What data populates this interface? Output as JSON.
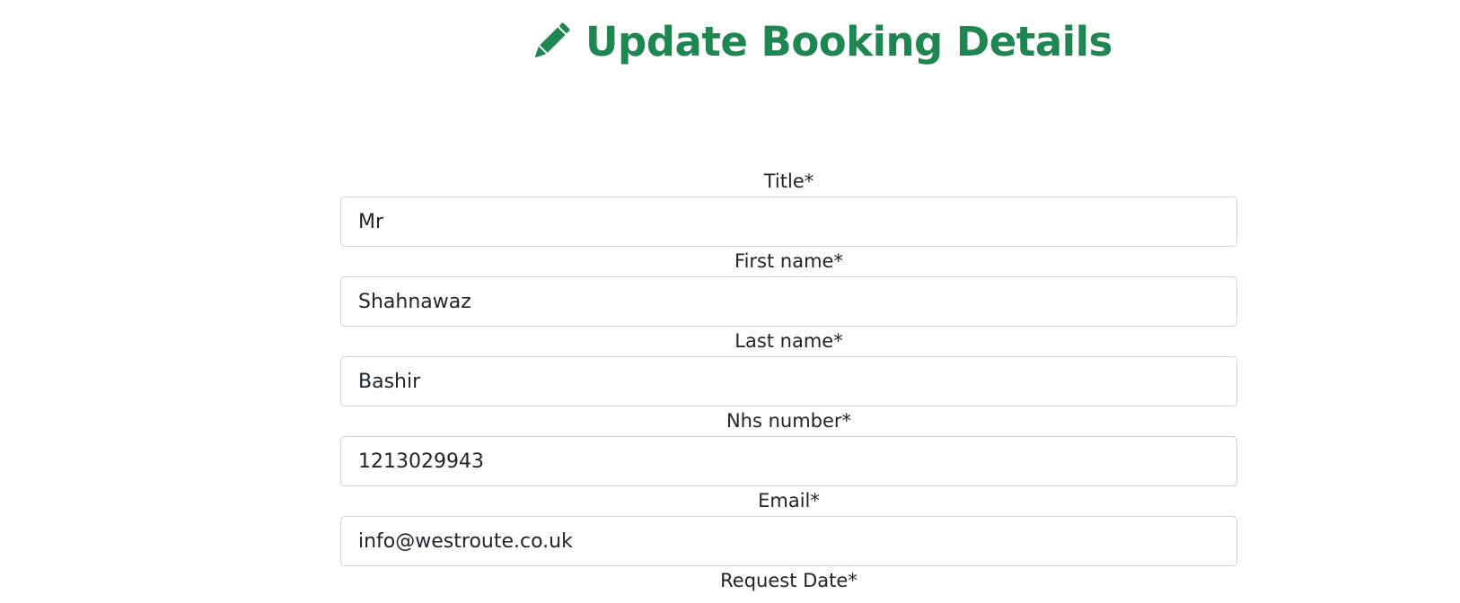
{
  "header": {
    "icon": "pencil-icon",
    "title": "Update Booking Details",
    "accent_color": "#1e8650"
  },
  "form": {
    "fields": [
      {
        "label": "Title*",
        "value": "Mr"
      },
      {
        "label": "First name*",
        "value": "Shahnawaz"
      },
      {
        "label": "Last name*",
        "value": "Bashir"
      },
      {
        "label": "Nhs number*",
        "value": "1213029943"
      },
      {
        "label": "Email*",
        "value": "info@westroute.co.uk"
      },
      {
        "label": "Request Date*"
      }
    ]
  }
}
